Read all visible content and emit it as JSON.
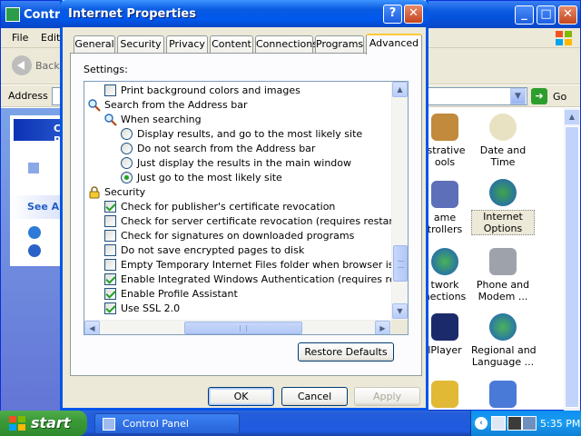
{
  "control_panel": {
    "title": "Control Panel",
    "menu": [
      "File",
      "Edit"
    ],
    "back_label": "Back",
    "address_label": "Address",
    "go_label": "Go",
    "task_title": "Control Panel",
    "see_also": "See Also",
    "icons": [
      {
        "label": "istrative\nools"
      },
      {
        "label": "Date and Time"
      },
      {
        "label": "ame\ntrollers"
      },
      {
        "label": "Internet\nOptions",
        "selected": true
      },
      {
        "label": "twork\nnections"
      },
      {
        "label": "Phone and\nModem ..."
      },
      {
        "label": "lPlayer"
      },
      {
        "label": "Regional and\nLanguage ..."
      }
    ]
  },
  "dialog": {
    "title": "Internet Properties",
    "tabs": [
      "General",
      "Security",
      "Privacy",
      "Content",
      "Connections",
      "Programs",
      "Advanced"
    ],
    "active_tab": "Advanced",
    "settings_label": "Settings:",
    "settings_items": [
      {
        "type": "checkbox",
        "checked": false,
        "indent": 1,
        "label": "Print background colors and images"
      },
      {
        "type": "search",
        "indent": 0,
        "label": "Search from the Address bar"
      },
      {
        "type": "search",
        "indent": 1,
        "label": "When searching"
      },
      {
        "type": "radio",
        "checked": false,
        "indent": 2,
        "label": "Display results, and go to the most likely site"
      },
      {
        "type": "radio",
        "checked": false,
        "indent": 2,
        "label": "Do not search from the Address bar"
      },
      {
        "type": "radio",
        "checked": false,
        "indent": 2,
        "label": "Just display the results in the main window"
      },
      {
        "type": "radio",
        "checked": true,
        "indent": 2,
        "label": "Just go to the most likely site"
      },
      {
        "type": "lock",
        "indent": 0,
        "label": "Security"
      },
      {
        "type": "checkbox",
        "checked": true,
        "indent": 1,
        "label": "Check for publisher's certificate revocation"
      },
      {
        "type": "checkbox",
        "checked": false,
        "indent": 1,
        "label": "Check for server certificate revocation (requires restart)"
      },
      {
        "type": "checkbox",
        "checked": false,
        "indent": 1,
        "label": "Check for signatures on downloaded programs"
      },
      {
        "type": "checkbox",
        "checked": false,
        "indent": 1,
        "label": "Do not save encrypted pages to disk"
      },
      {
        "type": "checkbox",
        "checked": false,
        "indent": 1,
        "label": "Empty Temporary Internet Files folder when browser is closed"
      },
      {
        "type": "checkbox",
        "checked": true,
        "indent": 1,
        "label": "Enable Integrated Windows Authentication (requires restart)"
      },
      {
        "type": "checkbox",
        "checked": true,
        "indent": 1,
        "label": "Enable Profile Assistant"
      },
      {
        "type": "checkbox",
        "checked": true,
        "indent": 1,
        "label": "Use SSL 2.0"
      }
    ],
    "restore_defaults": "Restore Defaults",
    "ok": "OK",
    "cancel": "Cancel",
    "apply": "Apply"
  },
  "taskbar": {
    "start": "start",
    "task_control_panel": "Control Panel",
    "clock": "5:35 PM"
  },
  "colors": {
    "title_blue": "#0a5ae0",
    "check_green": "#21a121",
    "active_tab_accent": "#ffc83c",
    "start_green": "#3b9a37"
  }
}
